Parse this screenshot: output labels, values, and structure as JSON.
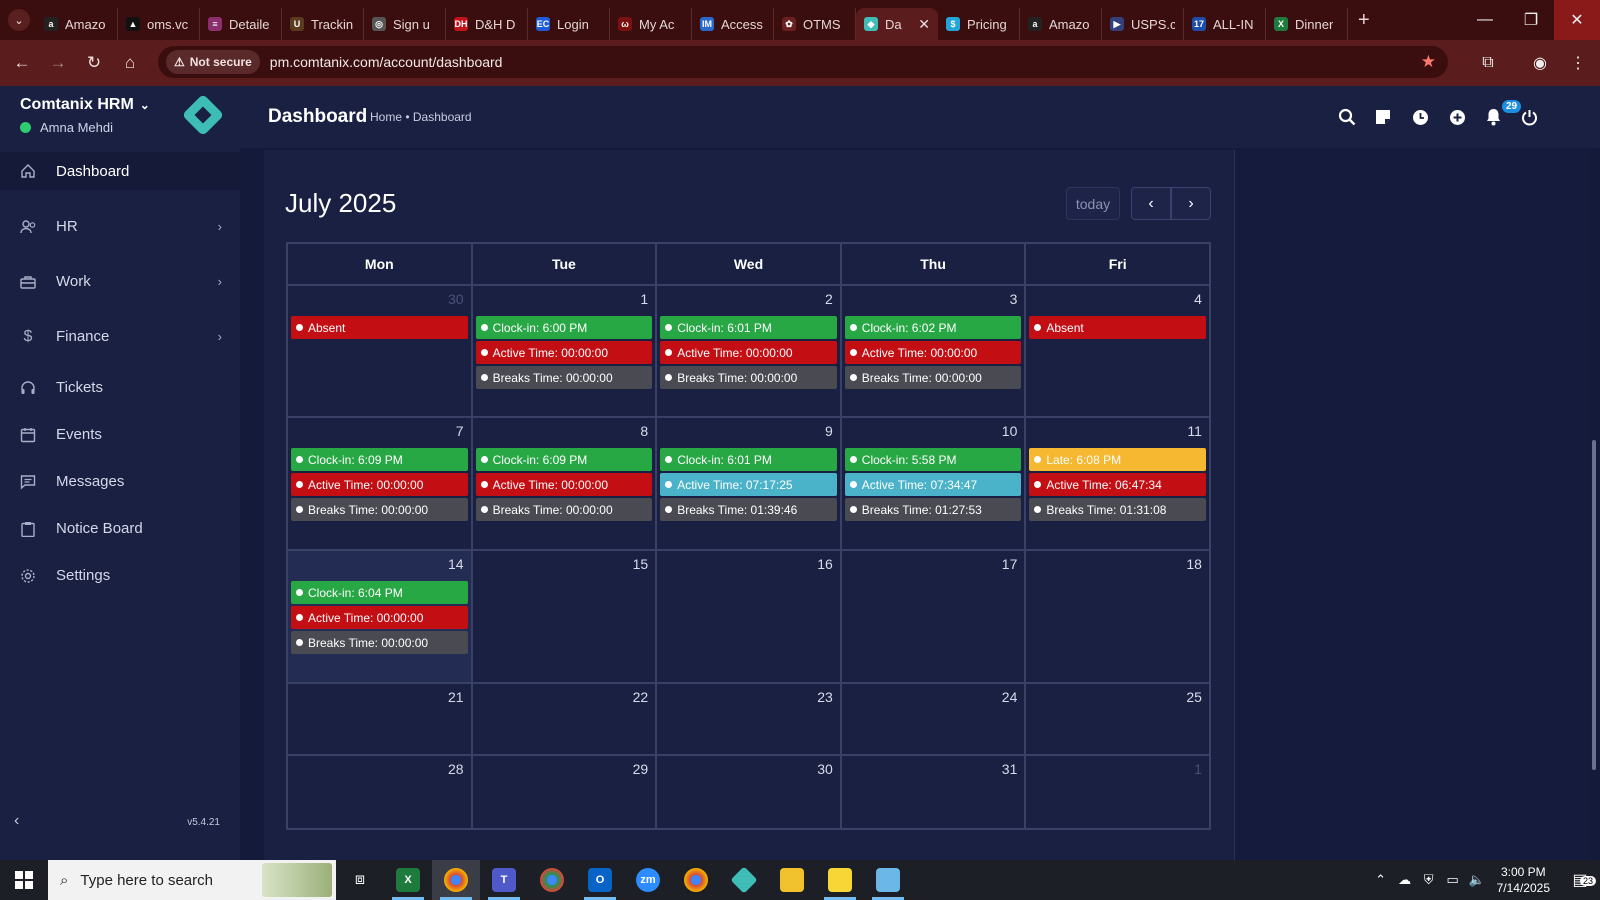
{
  "browser": {
    "tabs": [
      {
        "title": "Amazo",
        "fav_color": "#222",
        "fav_text": "a"
      },
      {
        "title": "oms.vc",
        "fav_color": "#111",
        "fav_text": "▲"
      },
      {
        "title": "Detaile",
        "fav_color": "#8b2f6f",
        "fav_text": "≡"
      },
      {
        "title": "Trackin",
        "fav_color": "#5a3b1e",
        "fav_text": "U"
      },
      {
        "title": "Sign u",
        "fav_color": "#555",
        "fav_text": "◎"
      },
      {
        "title": "D&H D",
        "fav_color": "#c0141c",
        "fav_text": "DH"
      },
      {
        "title": "Login",
        "fav_color": "#1e5bd8",
        "fav_text": "EC"
      },
      {
        "title": "My Ac",
        "fav_color": "#7a1010",
        "fav_text": "ω"
      },
      {
        "title": "Access",
        "fav_color": "#2a6acf",
        "fav_text": "IM"
      },
      {
        "title": "OTMS",
        "fav_color": "#6a2020",
        "fav_text": "✿"
      },
      {
        "title": "Da",
        "fav_color": "#3dbdb5",
        "fav_text": "◆"
      },
      {
        "title": "Pricing",
        "fav_color": "#22a6d8",
        "fav_text": "$"
      },
      {
        "title": "Amazo",
        "fav_color": "#222",
        "fav_text": "a"
      },
      {
        "title": "USPS.c",
        "fav_color": "#33407a",
        "fav_text": "▶"
      },
      {
        "title": "ALL-IN",
        "fav_color": "#1b4ea8",
        "fav_text": "17"
      },
      {
        "title": "Dinner",
        "fav_color": "#1f7a3e",
        "fav_text": "X"
      }
    ],
    "active_tab_index": 10,
    "security_label": "Not secure",
    "url": "pm.comtanix.com/account/dashboard"
  },
  "sidebar": {
    "company": "Comtanix HRM",
    "user": "Amna Mehdi",
    "items": [
      {
        "label": "Dashboard",
        "icon": "home-icon",
        "chevron": false
      },
      {
        "label": "HR",
        "icon": "people-icon",
        "chevron": true
      },
      {
        "label": "Work",
        "icon": "briefcase-icon",
        "chevron": true
      },
      {
        "label": "Finance",
        "icon": "dollar-icon",
        "chevron": true
      },
      {
        "label": "Tickets",
        "icon": "headset-icon",
        "chevron": false
      },
      {
        "label": "Events",
        "icon": "calendar-icon",
        "chevron": false
      },
      {
        "label": "Messages",
        "icon": "message-icon",
        "chevron": false
      },
      {
        "label": "Notice Board",
        "icon": "clipboard-icon",
        "chevron": false
      },
      {
        "label": "Settings",
        "icon": "gear-icon",
        "chevron": false
      }
    ],
    "version": "v5.4.21"
  },
  "header": {
    "title": "Dashboard",
    "breadcrumb": "Home • Dashboard",
    "notification_count": "29"
  },
  "calendar": {
    "month_title": "July 2025",
    "today_label": "today",
    "weekdays": [
      "Mon",
      "Tue",
      "Wed",
      "Thu",
      "Fri"
    ],
    "weeks": [
      [
        {
          "day": "30",
          "muted": true,
          "events": [
            {
              "text": "Absent",
              "color": "red"
            }
          ]
        },
        {
          "day": "1",
          "events": [
            {
              "text": "Clock-in: 6:00 PM",
              "color": "green"
            },
            {
              "text": "Active Time: 00:00:00",
              "color": "red"
            },
            {
              "text": "Breaks Time: 00:00:00",
              "color": "gray"
            }
          ]
        },
        {
          "day": "2",
          "events": [
            {
              "text": "Clock-in: 6:01 PM",
              "color": "green"
            },
            {
              "text": "Active Time: 00:00:00",
              "color": "red"
            },
            {
              "text": "Breaks Time: 00:00:00",
              "color": "gray"
            }
          ]
        },
        {
          "day": "3",
          "events": [
            {
              "text": "Clock-in: 6:02 PM",
              "color": "green"
            },
            {
              "text": "Active Time: 00:00:00",
              "color": "red"
            },
            {
              "text": "Breaks Time: 00:00:00",
              "color": "gray"
            }
          ]
        },
        {
          "day": "4",
          "events": [
            {
              "text": "Absent",
              "color": "red"
            }
          ]
        }
      ],
      [
        {
          "day": "7",
          "events": [
            {
              "text": "Clock-in: 6:09 PM",
              "color": "green"
            },
            {
              "text": "Active Time: 00:00:00",
              "color": "red"
            },
            {
              "text": "Breaks Time: 00:00:00",
              "color": "gray"
            }
          ]
        },
        {
          "day": "8",
          "events": [
            {
              "text": "Clock-in: 6:09 PM",
              "color": "green"
            },
            {
              "text": "Active Time: 00:00:00",
              "color": "red"
            },
            {
              "text": "Breaks Time: 00:00:00",
              "color": "gray"
            }
          ]
        },
        {
          "day": "9",
          "events": [
            {
              "text": "Clock-in: 6:01 PM",
              "color": "green"
            },
            {
              "text": "Active Time: 07:17:25",
              "color": "teal"
            },
            {
              "text": "Breaks Time: 01:39:46",
              "color": "gray"
            }
          ]
        },
        {
          "day": "10",
          "events": [
            {
              "text": "Clock-in: 5:58 PM",
              "color": "green"
            },
            {
              "text": "Active Time: 07:34:47",
              "color": "teal"
            },
            {
              "text": "Breaks Time: 01:27:53",
              "color": "gray"
            }
          ]
        },
        {
          "day": "11",
          "events": [
            {
              "text": "Late: 6:08 PM",
              "color": "yellow"
            },
            {
              "text": "Active Time: 06:47:34",
              "color": "red"
            },
            {
              "text": "Breaks Time: 01:31:08",
              "color": "gray"
            }
          ]
        }
      ],
      [
        {
          "day": "14",
          "today": true,
          "events": [
            {
              "text": "Clock-in: 6:04 PM",
              "color": "green"
            },
            {
              "text": "Active Time: 00:00:00",
              "color": "red"
            },
            {
              "text": "Breaks Time: 00:00:00",
              "color": "gray"
            }
          ]
        },
        {
          "day": "15",
          "events": []
        },
        {
          "day": "16",
          "events": []
        },
        {
          "day": "17",
          "events": []
        },
        {
          "day": "18",
          "events": []
        }
      ],
      [
        {
          "day": "21",
          "events": []
        },
        {
          "day": "22",
          "events": []
        },
        {
          "day": "23",
          "events": []
        },
        {
          "day": "24",
          "events": []
        },
        {
          "day": "25",
          "events": []
        }
      ],
      [
        {
          "day": "28",
          "events": []
        },
        {
          "day": "29",
          "events": []
        },
        {
          "day": "30",
          "events": []
        },
        {
          "day": "31",
          "events": []
        },
        {
          "day": "1",
          "muted": true,
          "events": []
        }
      ]
    ]
  },
  "taskbar": {
    "search_placeholder": "Type here to search",
    "time": "3:00 PM",
    "date": "7/14/2025",
    "notification_count": "23"
  }
}
